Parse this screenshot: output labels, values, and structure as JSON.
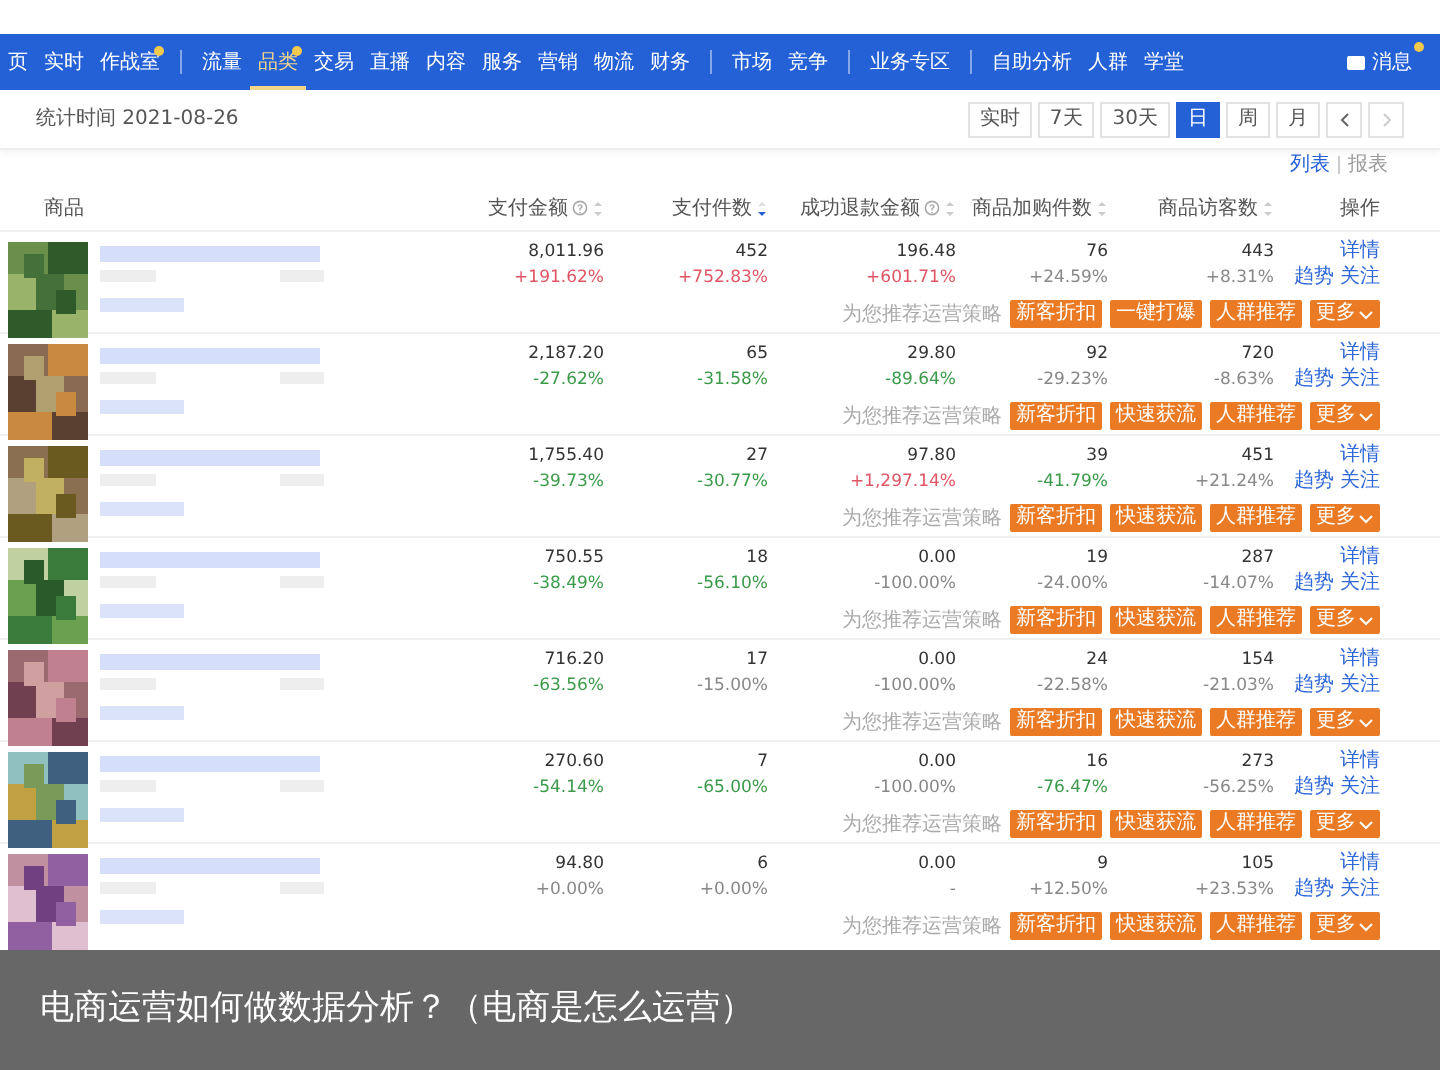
{
  "nav": {
    "groups": [
      [
        {
          "label": "页",
          "selected": false,
          "badge": false
        },
        {
          "label": "实时",
          "selected": false,
          "badge": false
        },
        {
          "label": "作战室",
          "selected": false,
          "badge": true
        }
      ],
      [
        {
          "label": "流量",
          "selected": false,
          "badge": false
        },
        {
          "label": "品类",
          "selected": true,
          "badge": true
        },
        {
          "label": "交易",
          "selected": false,
          "badge": false
        },
        {
          "label": "直播",
          "selected": false,
          "badge": false
        },
        {
          "label": "内容",
          "selected": false,
          "badge": false
        },
        {
          "label": "服务",
          "selected": false,
          "badge": false
        },
        {
          "label": "营销",
          "selected": false,
          "badge": false
        },
        {
          "label": "物流",
          "selected": false,
          "badge": false
        },
        {
          "label": "财务",
          "selected": false,
          "badge": false
        }
      ],
      [
        {
          "label": "市场",
          "selected": false,
          "badge": false
        },
        {
          "label": "竞争",
          "selected": false,
          "badge": false
        }
      ],
      [
        {
          "label": "业务专区",
          "selected": false,
          "badge": false
        }
      ],
      [
        {
          "label": "自助分析",
          "selected": false,
          "badge": false
        },
        {
          "label": "人群",
          "selected": false,
          "badge": false
        },
        {
          "label": "学堂",
          "selected": false,
          "badge": false
        }
      ]
    ],
    "message": {
      "label": "消息",
      "badge": true
    }
  },
  "toolbar": {
    "stat_time": "统计时间 2021-08-26",
    "ranges": [
      {
        "label": "实时",
        "selected": false
      },
      {
        "label": "7天",
        "selected": false
      },
      {
        "label": "30天",
        "selected": false
      },
      {
        "label": "日",
        "selected": true
      },
      {
        "label": "周",
        "selected": false
      },
      {
        "label": "月",
        "selected": false
      }
    ],
    "pager": {
      "prev_disabled": false,
      "next_disabled": true
    }
  },
  "view_switch": [
    {
      "label": "列表",
      "selected": true
    },
    {
      "label": "报表",
      "selected": false
    }
  ],
  "table": {
    "columns": [
      {
        "label": "商品"
      },
      {
        "label": "支付金额",
        "info": true,
        "sortable": true,
        "sorted": false
      },
      {
        "label": "支付件数",
        "sortable": true,
        "sorted": true
      },
      {
        "label": "成功退款金额",
        "info": true,
        "sortable": true,
        "sorted": false
      },
      {
        "label": "商品加购件数",
        "sortable": true,
        "sorted": false
      },
      {
        "label": "商品访客数",
        "sortable": true,
        "sorted": false
      },
      {
        "label": "操作"
      }
    ],
    "rows": [
      {
        "image": {
          "kind": "picture"
        },
        "metrics": [
          {
            "value": "8,011.96",
            "change": "+191.62%",
            "color": "#e05566"
          },
          {
            "value": "452",
            "change": "+752.83%",
            "color": "#e05566"
          },
          {
            "value": "196.48",
            "change": "+601.71%",
            "color": "#e05566"
          },
          {
            "value": "76",
            "change": "+24.59%",
            "color": "#888888"
          },
          {
            "value": "443",
            "change": "+8.31%",
            "color": "#888888"
          }
        ],
        "actions": [
          "详情",
          "趋势",
          "关注"
        ],
        "strategy_label": "为您推荐运营策略",
        "strategies": [
          "新客折扣",
          "一键打爆",
          "人群推荐"
        ],
        "more": "更多"
      },
      {
        "image": {
          "kind": "picture"
        },
        "metrics": [
          {
            "value": "2,187.20",
            "change": "-27.62%",
            "color": "#3b9a4a"
          },
          {
            "value": "65",
            "change": "-31.58%",
            "color": "#3b9a4a"
          },
          {
            "value": "29.80",
            "change": "-89.64%",
            "color": "#3b9a4a"
          },
          {
            "value": "92",
            "change": "-29.23%",
            "color": "#888888"
          },
          {
            "value": "720",
            "change": "-8.63%",
            "color": "#888888"
          }
        ],
        "actions": [
          "详情",
          "趋势",
          "关注"
        ],
        "strategy_label": "为您推荐运营策略",
        "strategies": [
          "新客折扣",
          "快速获流",
          "人群推荐"
        ],
        "more": "更多"
      },
      {
        "image": {
          "kind": "picture"
        },
        "metrics": [
          {
            "value": "1,755.40",
            "change": "-39.73%",
            "color": "#3b9a4a"
          },
          {
            "value": "27",
            "change": "-30.77%",
            "color": "#3b9a4a"
          },
          {
            "value": "97.80",
            "change": "+1,297.14%",
            "color": "#e05566"
          },
          {
            "value": "39",
            "change": "-41.79%",
            "color": "#3b9a4a"
          },
          {
            "value": "451",
            "change": "+21.24%",
            "color": "#888888"
          }
        ],
        "actions": [
          "详情",
          "趋势",
          "关注"
        ],
        "strategy_label": "为您推荐运营策略",
        "strategies": [
          "新客折扣",
          "快速获流",
          "人群推荐"
        ],
        "more": "更多"
      },
      {
        "image": {
          "kind": "picture"
        },
        "metrics": [
          {
            "value": "750.55",
            "change": "-38.49%",
            "color": "#3b9a4a"
          },
          {
            "value": "18",
            "change": "-56.10%",
            "color": "#3b9a4a"
          },
          {
            "value": "0.00",
            "change": "-100.00%",
            "color": "#888888"
          },
          {
            "value": "19",
            "change": "-24.00%",
            "color": "#888888"
          },
          {
            "value": "287",
            "change": "-14.07%",
            "color": "#888888"
          }
        ],
        "actions": [
          "详情",
          "趋势",
          "关注"
        ],
        "strategy_label": "为您推荐运营策略",
        "strategies": [
          "新客折扣",
          "快速获流",
          "人群推荐"
        ],
        "more": "更多"
      },
      {
        "image": {
          "kind": "picture"
        },
        "metrics": [
          {
            "value": "716.20",
            "change": "-63.56%",
            "color": "#3b9a4a"
          },
          {
            "value": "17",
            "change": "-15.00%",
            "color": "#888888"
          },
          {
            "value": "0.00",
            "change": "-100.00%",
            "color": "#888888"
          },
          {
            "value": "24",
            "change": "-22.58%",
            "color": "#888888"
          },
          {
            "value": "154",
            "change": "-21.03%",
            "color": "#888888"
          }
        ],
        "actions": [
          "详情",
          "趋势",
          "关注"
        ],
        "strategy_label": "为您推荐运营策略",
        "strategies": [
          "新客折扣",
          "快速获流",
          "人群推荐"
        ],
        "more": "更多"
      },
      {
        "image": {
          "kind": "picture"
        },
        "metrics": [
          {
            "value": "270.60",
            "change": "-54.14%",
            "color": "#3b9a4a"
          },
          {
            "value": "7",
            "change": "-65.00%",
            "color": "#3b9a4a"
          },
          {
            "value": "0.00",
            "change": "-100.00%",
            "color": "#888888"
          },
          {
            "value": "16",
            "change": "-76.47%",
            "color": "#3b9a4a"
          },
          {
            "value": "273",
            "change": "-56.25%",
            "color": "#888888"
          }
        ],
        "actions": [
          "详情",
          "趋势",
          "关注"
        ],
        "strategy_label": "为您推荐运营策略",
        "strategies": [
          "新客折扣",
          "快速获流",
          "人群推荐"
        ],
        "more": "更多"
      },
      {
        "image": {
          "kind": "picture"
        },
        "metrics": [
          {
            "value": "94.80",
            "change": "+0.00%",
            "color": "#888888"
          },
          {
            "value": "6",
            "change": "+0.00%",
            "color": "#888888"
          },
          {
            "value": "0.00",
            "change": "-",
            "color": "#888888"
          },
          {
            "value": "9",
            "change": "+12.50%",
            "color": "#888888"
          },
          {
            "value": "105",
            "change": "+23.53%",
            "color": "#888888"
          }
        ],
        "actions": [
          "详情",
          "趋势",
          "关注"
        ],
        "strategy_label": "为您推荐运营策略",
        "strategies": [
          "新客折扣",
          "快速获流",
          "人群推荐"
        ],
        "more": "更多"
      }
    ]
  },
  "caption": "电商运营如何做数据分析？（电商是怎么运营）"
}
